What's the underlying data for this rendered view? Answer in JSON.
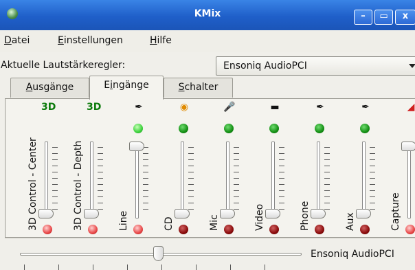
{
  "window": {
    "title": "KMix"
  },
  "menu": {
    "file": "Datei",
    "settings": "Einstellungen",
    "help": "Hilfe"
  },
  "mixer_select": {
    "label": "Aktuelle Lautstärkeregler:",
    "value": "Ensoniq AudioPCI"
  },
  "tabs": [
    {
      "label": "Ausgänge",
      "active": false
    },
    {
      "label": "Eingänge",
      "active": true
    },
    {
      "label": "Schalter",
      "active": false
    }
  ],
  "channels": [
    {
      "label": "3D Control - Center",
      "icon": "3d-icon",
      "icon_text": "3D",
      "capture_led": false,
      "record_led": "red",
      "level": 0.0
    },
    {
      "label": "3D Control - Depth",
      "icon": "3d-icon",
      "icon_text": "3D",
      "capture_led": false,
      "record_led": "red",
      "level": 0.0
    },
    {
      "label": "Line",
      "icon": "line-jack-icon",
      "icon_text": "",
      "capture_led": "bright-green",
      "record_led": "red",
      "level": 1.0
    },
    {
      "label": "CD",
      "icon": "cd-icon",
      "icon_text": "",
      "capture_led": "green",
      "record_led": "dark-red",
      "level": 0.0
    },
    {
      "label": "Mic",
      "icon": "microphone-icon",
      "icon_text": "",
      "capture_led": "green",
      "record_led": "dark-red",
      "level": 0.0
    },
    {
      "label": "Video",
      "icon": "video-icon",
      "icon_text": "",
      "capture_led": "green",
      "record_led": "dark-red",
      "level": 0.0
    },
    {
      "label": "Phone",
      "icon": "phone-jack-icon",
      "icon_text": "",
      "capture_led": "green",
      "record_led": "dark-red",
      "level": 0.0
    },
    {
      "label": "Aux",
      "icon": "aux-jack-icon",
      "icon_text": "",
      "capture_led": "green",
      "record_led": "dark-red",
      "level": 0.0
    },
    {
      "label": "Capture",
      "icon": "capture-icon",
      "icon_text": "",
      "capture_led": false,
      "record_led": "red",
      "level": 1.0
    }
  ],
  "balance": {
    "label": "Ensoniq AudioPCI",
    "position": 0.5
  },
  "colors": {
    "titlebar": "#1f5fc9",
    "led_green": "#19a019",
    "led_red": "#e05050"
  }
}
